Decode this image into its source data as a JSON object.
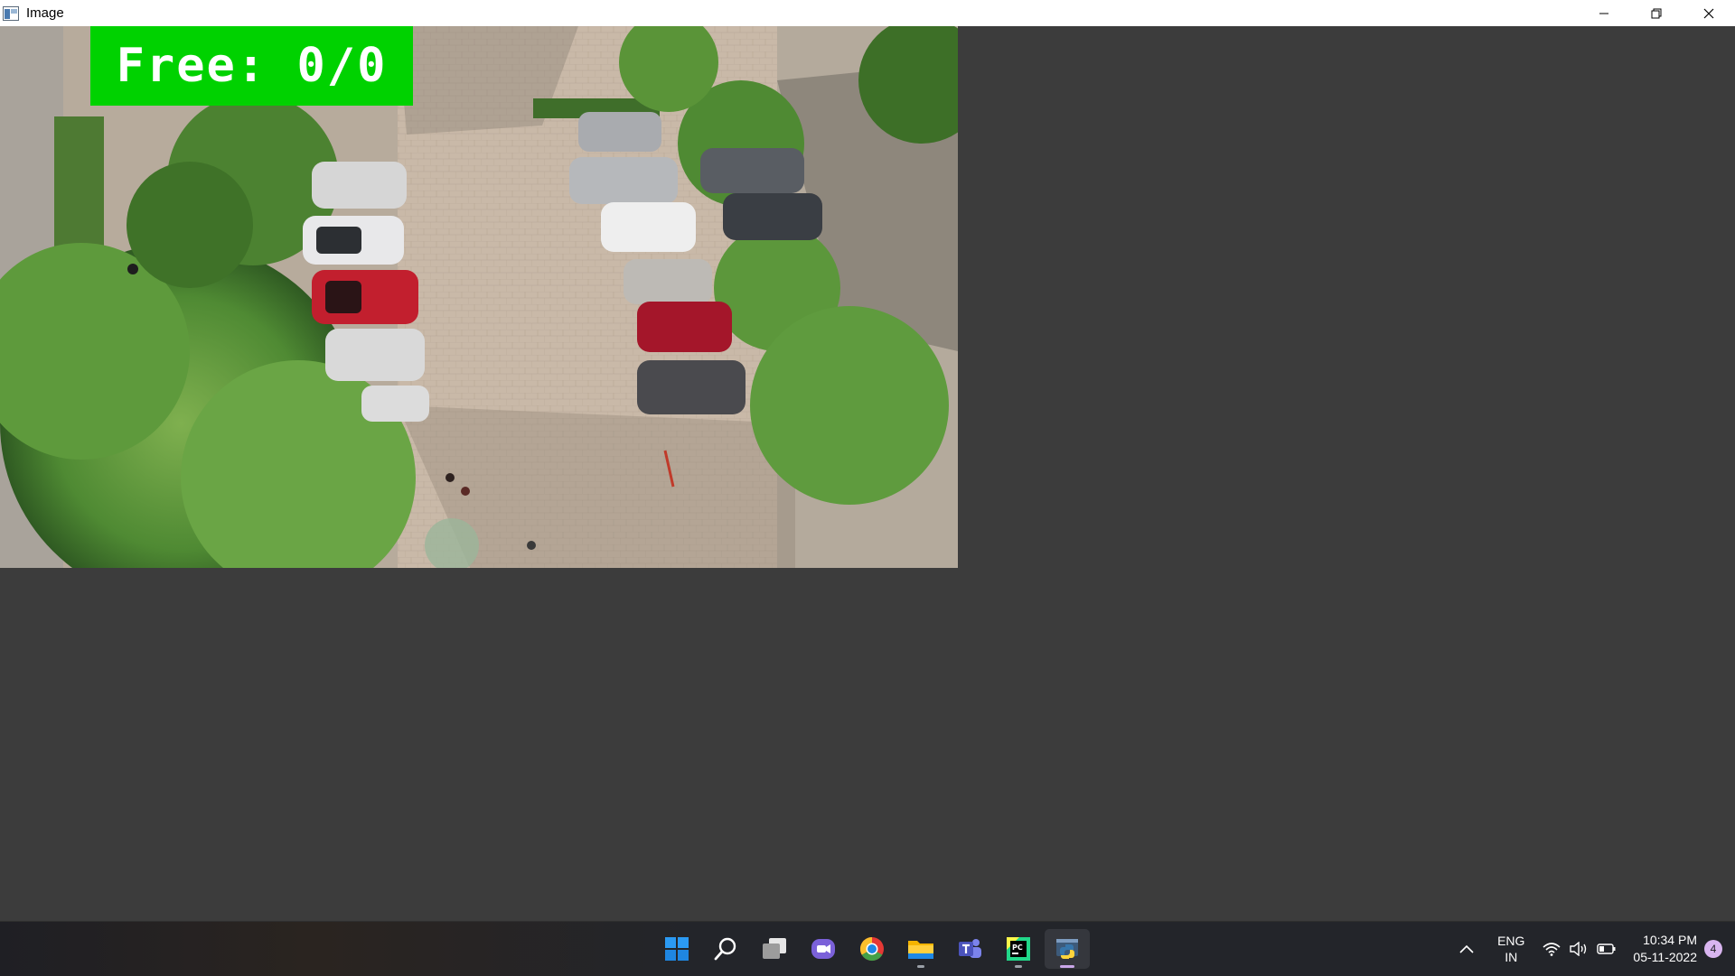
{
  "window": {
    "title": "Image",
    "controls": [
      "minimize-icon",
      "restore-icon",
      "close-icon"
    ]
  },
  "overlay": {
    "text": "Free: 0/0",
    "color": "#00d200"
  },
  "taskbar": {
    "apps": [
      {
        "name": "start",
        "icon": "windows-logo-icon",
        "running": false
      },
      {
        "name": "search",
        "icon": "search-icon",
        "running": false
      },
      {
        "name": "task-view",
        "icon": "task-view-icon",
        "running": false
      },
      {
        "name": "chat",
        "icon": "video-chat-icon",
        "running": false
      },
      {
        "name": "chrome",
        "icon": "chrome-icon",
        "running": false
      },
      {
        "name": "file-explorer",
        "icon": "folder-icon",
        "running": true
      },
      {
        "name": "teams",
        "icon": "teams-icon",
        "running": false
      },
      {
        "name": "pycharm",
        "icon": "pycharm-icon",
        "running": true
      },
      {
        "name": "python",
        "icon": "python-icon",
        "running": true,
        "active": true
      }
    ],
    "tray": {
      "lang_top": "ENG",
      "lang_bottom": "IN",
      "time": "10:34 PM",
      "date": "05-11-2022",
      "notifications": "4"
    }
  }
}
